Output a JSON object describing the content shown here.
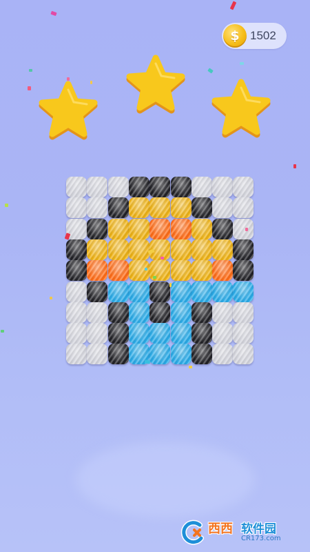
{
  "hud": {
    "coins": "1502",
    "coin_symbol": "$"
  },
  "stars": {
    "earned": 3,
    "total": 3,
    "color": "#f8c81c",
    "shadow": "#e3941a"
  },
  "puzzle": {
    "rows": 9,
    "cols": 9,
    "palette": {
      "W": "white",
      "K": "black",
      "Y": "yellow",
      "O": "orange",
      "B": "blue"
    },
    "pattern": [
      "WWWKKKWWW",
      "WWKYYYKWW",
      "WKYYOOYKW",
      "KYYYYYYYK",
      "KOOYYYYOK",
      "WKBBKBBBB",
      "WWKBKBKWW",
      "WWKBBBKWW",
      "WWKBBBKWW"
    ]
  },
  "watermark": {
    "brand": "西西",
    "site": "软件园",
    "domain": "CR173.com",
    "colors": {
      "brand": "#f3741f",
      "site": "#1e8fd8"
    }
  }
}
